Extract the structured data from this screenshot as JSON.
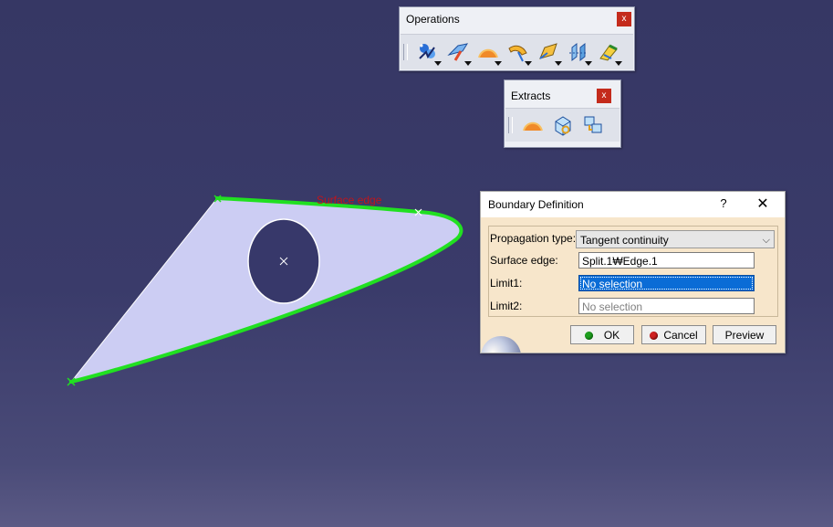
{
  "viewport": {
    "annotation": "Surface edge",
    "colors": {
      "surface_fill": "#cccdf3",
      "boundary": "#21e021",
      "annotation": "#c0151b"
    }
  },
  "operations_toolbar": {
    "title": "Operations",
    "close_label": "x",
    "icons": [
      "join-icon",
      "healing-icon",
      "boundary-icon",
      "split-icon",
      "trim-icon",
      "translate-icon",
      "extrapolate-icon"
    ]
  },
  "extracts_toolbar": {
    "title": "Extracts",
    "close_label": "x",
    "icons": [
      "boundary-icon",
      "extract-icon",
      "multiple-extract-icon"
    ]
  },
  "dialog": {
    "title": "Boundary Definition",
    "help_label": "?",
    "close_label": "✕",
    "propagation_label": "Propagation type:",
    "propagation_value": "Tangent continuity",
    "surface_edge_label": "Surface edge:",
    "surface_edge_value": "Split.1₩Edge.1",
    "limit1_label": "Limit1:",
    "limit1_value": "No selection",
    "limit2_label": "Limit2:",
    "limit2_value": "No selection",
    "ok_label": "OK",
    "cancel_label": "Cancel",
    "preview_label": "Preview"
  }
}
